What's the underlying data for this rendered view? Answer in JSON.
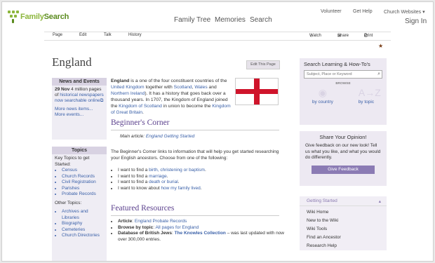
{
  "brand": {
    "name_a": "Family",
    "name_b": "Search"
  },
  "main_nav": [
    "Family Tree",
    "Memories",
    "Search"
  ],
  "util_nav": [
    "Volunteer",
    "Get Help",
    "Church Websites"
  ],
  "signin": "Sign In",
  "tabs": [
    "Page",
    "Edit",
    "Talk",
    "History"
  ],
  "tab_actions": [
    "Watch",
    "Share",
    "Print"
  ],
  "page_title": "England",
  "edit_button": "Edit This Page",
  "news": {
    "heading": "News and Events",
    "date": "29 Nov",
    "text1": "4 million pages of",
    "link": "historical newspapers now searchable online",
    "more1": "More news items...",
    "more2": "More events..."
  },
  "topics": {
    "heading": "Topics",
    "intro": "Key Topics to get Started:",
    "key": [
      "Census",
      "Church Records",
      "Civil Registration",
      "Parishes",
      "Probate Records"
    ],
    "other_label": "Other Topics:",
    "other": [
      "Archives and Libraries",
      "Biography",
      "Cemeteries",
      "Church Directories"
    ]
  },
  "intro": {
    "t1": "England",
    "t2": " is a one of the four constituent countries of the ",
    "l1": "United Kingdom",
    "t3": " together with ",
    "l2": "Scotland",
    "t4": ", ",
    "l3": "Wales",
    "t5": " and ",
    "l4": "Northern Ireland",
    "t6": "). It has a history that goes back over a thousand years. In 1707, the Kingdom of England joined the ",
    "l5": "Kingdom of Scotland",
    "t7": " in union to become the ",
    "l6": "Kingdom of Great Britain",
    "t8": "."
  },
  "beginners": {
    "heading": "Beginner's Corner",
    "main_label": "Main article: ",
    "main_link": "England Getting Started",
    "para": "The Beginner's Corner links to information that will help you get started researching your English ancestors. Choose from one of the following:",
    "items": [
      {
        "pre": "I want to find a ",
        "link": "birth, christening or baptism",
        "post": "."
      },
      {
        "pre": "I want to find a ",
        "link": "marriage",
        "post": "."
      },
      {
        "pre": "I want to find a ",
        "link": "death or burial",
        "post": "."
      },
      {
        "pre": "I want to know about ",
        "link": "how my family lived",
        "post": "."
      }
    ]
  },
  "featured": {
    "heading": "Featured Resources",
    "items": [
      {
        "label": "Article",
        "pre": ": ",
        "link": "England Probate Records",
        "post": ""
      },
      {
        "label": "Browse by topic",
        "pre": ": ",
        "link": "All pages for England",
        "post": ""
      },
      {
        "label": "Database of British Jews",
        "pre": ": ",
        "link": "The Knowles Collection",
        "post": " – was last updated with now over 300,000 entries."
      }
    ]
  },
  "search_box": {
    "title": "Search Learning & How-To's",
    "placeholder": "Subject, Place or Keyword",
    "browse": "BROWSE",
    "by_country": "by country",
    "by_topic": "by topic"
  },
  "opinion": {
    "title": "Share Your Opinion!",
    "text": "Give feedback on our new look! Tell us what you like, and what you would do differently.",
    "button": "Give Feedback"
  },
  "getting_started": {
    "heading": "Getting Started",
    "items": [
      "Wiki Home",
      "New to the Wiki",
      "Wiki Tools",
      "Find an Ancestor",
      "Research Help"
    ]
  },
  "colors": {
    "accent": "#5a3f8c",
    "link": "#3a60a8",
    "logo_green": "#8cb63c",
    "flag_red": "#cf142b"
  }
}
